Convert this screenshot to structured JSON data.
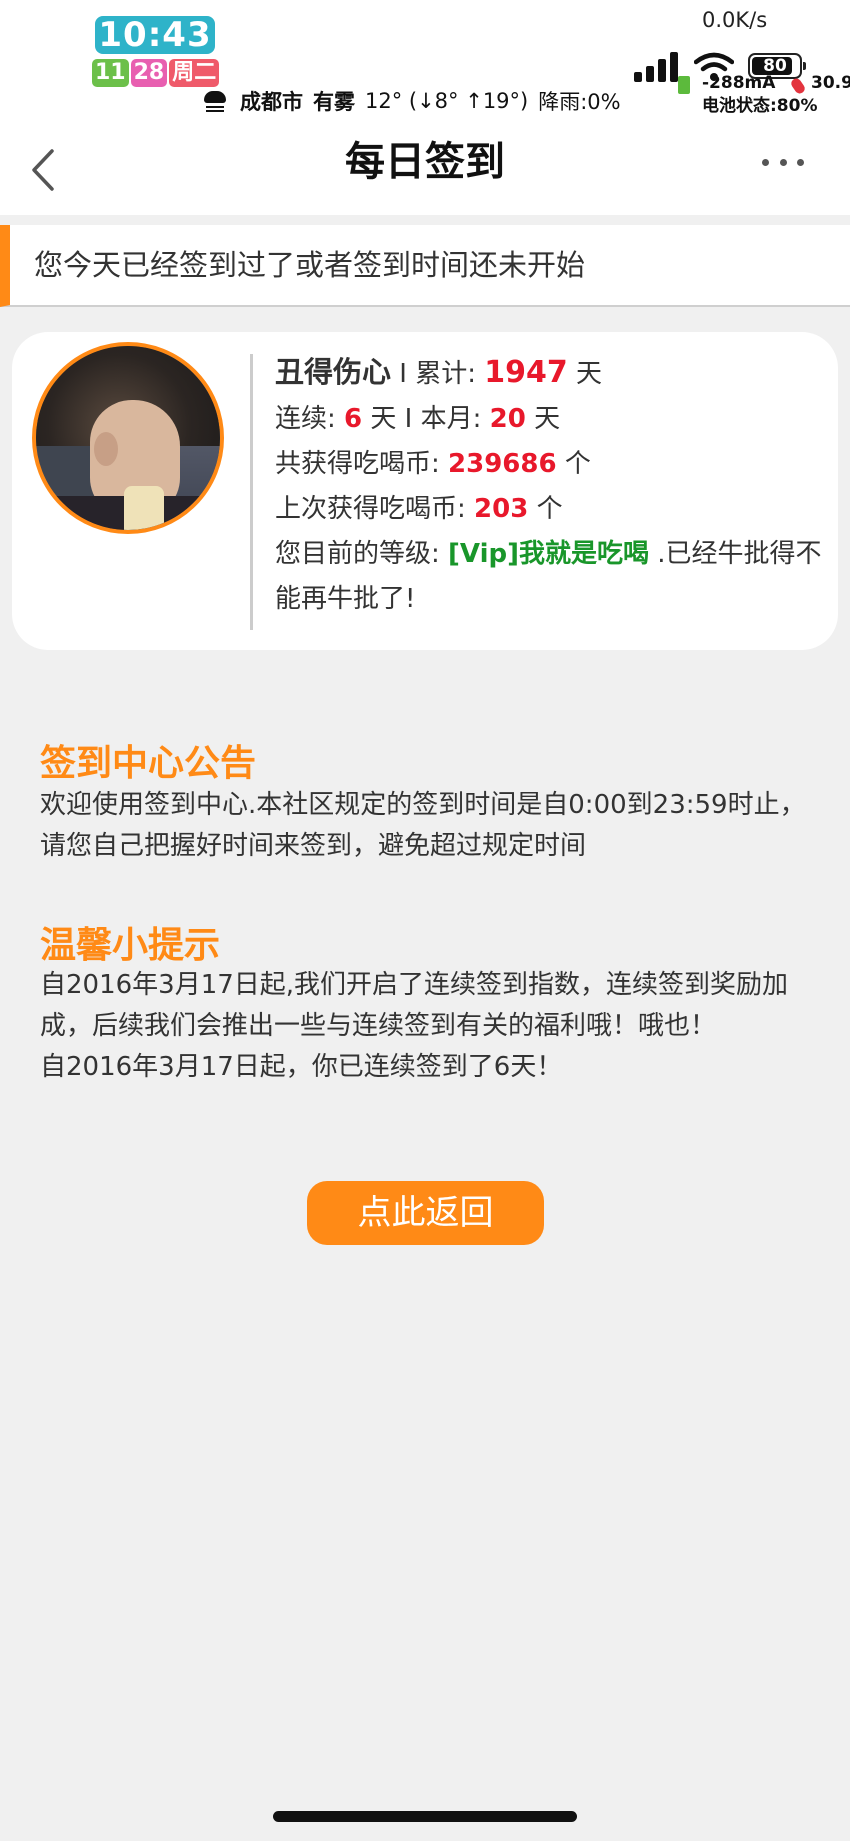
{
  "status_bar": {
    "time": "10:43",
    "date_month": "11",
    "date_day": "28",
    "weekday": "周二",
    "net_speed": "0.0K/s",
    "city": "成都市",
    "weather_condition": "有雾",
    "weather_detail": "12° (↓8°  ↑19°)",
    "rain": "降雨:0%",
    "battery_level": "80",
    "current": "-288mA",
    "battery_status": "电池状态:80%",
    "temperature": "30.9",
    "icons": [
      "cloud-icon",
      "signal-icon",
      "wifi-icon",
      "battery-icon",
      "temperature-icon"
    ]
  },
  "nav": {
    "title": "每日签到",
    "back_icon": "chevron-left-icon",
    "more_icon": "more-dots-icon"
  },
  "notice": {
    "text": "您今天已经签到过了或者签到时间还未开始",
    "accent_color": "#ff8a16"
  },
  "user": {
    "name": "丑得伤心",
    "sep1": " I ",
    "total_label": "累计: ",
    "total_days": "1947",
    "day_unit": " 天",
    "streak_label": "连续: ",
    "streak_days": "6",
    "streak_sep": " 天 I 本月: ",
    "month_days": "20",
    "month_unit": " 天",
    "coins_label": "共获得吃喝币: ",
    "coins_total": "239686",
    "coin_unit": " 个",
    "last_label": "上次获得吃喝币: ",
    "last_coins": "203",
    "last_unit": " 个",
    "level_label": "您目前的等级: ",
    "level_name": "[Vip]我就是吃喝",
    "level_suffix": " .已经牛批得不能再牛批了!"
  },
  "announcement": {
    "title": "签到中心公告",
    "body": "欢迎使用签到中心.本社区规定的签到时间是自0:00到23:59时止，请您自己把握好时间来签到，避免超过规定时间"
  },
  "tips": {
    "title": "温馨小提示",
    "line1": "自2016年3月17日起,我们开启了连续签到指数，连续签到奖励加成，后续我们会推出一些与连续签到有关的福利哦！哦也！",
    "line2": "自2016年3月17日起，你已连续签到了6天！"
  },
  "return_button": {
    "label": "点此返回"
  },
  "colors": {
    "accent": "#ff8a16",
    "highlight_red": "#e8182b",
    "level_green": "#19962a",
    "background": "#f0f0f0"
  }
}
